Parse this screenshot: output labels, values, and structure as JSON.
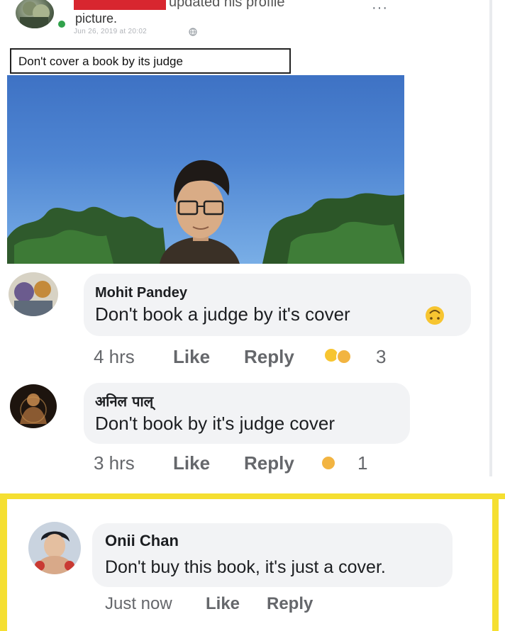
{
  "post": {
    "action_text": "updated his profile",
    "action_text_cont": "picture.",
    "date": "Jun 26, 2019 at 20:02",
    "more": "···",
    "caption": "Don't cover a book by its judge"
  },
  "comments": [
    {
      "name": "Mohit Pandey",
      "text": "Don't book a judge by it's cover",
      "time": "4 hrs",
      "like": "Like",
      "reply": "Reply",
      "reaction_count": "3"
    },
    {
      "name": "अनिल पाल्",
      "text": "Don't book by it's judge cover",
      "time": "3 hrs",
      "like": "Like",
      "reply": "Reply",
      "reaction_count": "1"
    }
  ],
  "highlighted_comment": {
    "name": "Onii Chan",
    "text": "Don't buy this book, it's just a cover.",
    "time": "Just now",
    "like": "Like",
    "reply": "Reply"
  },
  "colors": {
    "highlight": "#f5df31",
    "bubble": "#f2f3f5",
    "meta": "#65676b",
    "online": "#31a24c"
  }
}
